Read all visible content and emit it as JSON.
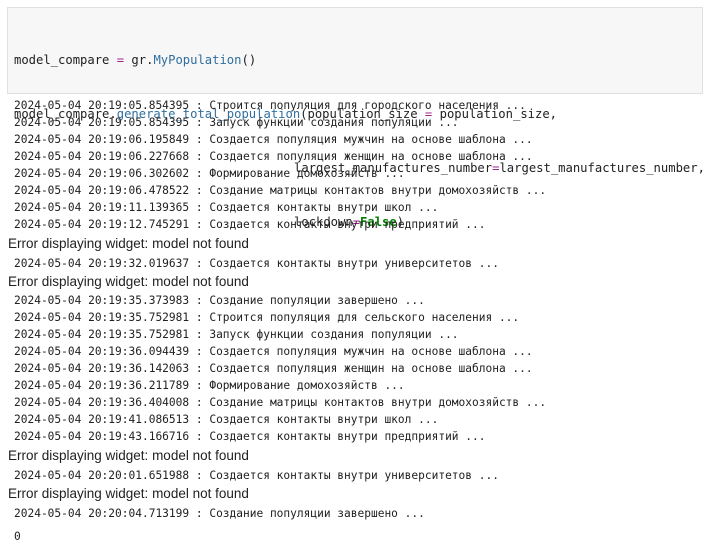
{
  "code": {
    "l1_var": "model_compare",
    "l1_op": "=",
    "l1_obj": "gr.",
    "l1_fn": "MyPopulation",
    "l1_end": "()",
    "l2_obj": "model_compare.",
    "l2_fn": "generate_total_population",
    "l2_arg": "(population_size",
    "l2_op": "=",
    "l2_rest": " population_size,",
    "l3_arg": "largest_manufactures_number",
    "l3_op": "=",
    "l3_rest": "largest_manufactures_number,",
    "l4_arg": "lockdown",
    "l4_op": "=",
    "l4_kw": "False",
    "l4_end": ")"
  },
  "output": {
    "log_1": [
      "2024-05-04 20:19:05.854395 : Строится популяция для городского населения ...",
      "2024-05-04 20:19:05.854395 : Запуск функции создания популяции ...",
      "2024-05-04 20:19:06.195849 : Создается популяция мужчин на основе шаблона ...",
      "2024-05-04 20:19:06.227668 : Создается популяция женщин на основе шаблона ...",
      "2024-05-04 20:19:06.302602 : Формирование домохозяйств ...",
      "2024-05-04 20:19:06.478522 : Создание матрицы контактов внутри домохозяйств ...",
      "2024-05-04 20:19:11.139365 : Создается контакты внутри школ ...",
      "2024-05-04 20:19:12.745291 : Создается контакты внутри предприятий ..."
    ],
    "error_1": "Error displaying widget: model not found",
    "log_2": [
      "2024-05-04 20:19:32.019637 : Создается контакты внутри университетов ..."
    ],
    "error_2": "Error displaying widget: model not found",
    "log_3": [
      "2024-05-04 20:19:35.373983 : Создание популяции завершено ...",
      "2024-05-04 20:19:35.752981 : Строится популяция для сельского населения ...",
      "2024-05-04 20:19:35.752981 : Запуск функции создания популяции ...",
      "2024-05-04 20:19:36.094439 : Создается популяция мужчин на основе шаблона ...",
      "2024-05-04 20:19:36.142063 : Создается популяция женщин на основе шаблона ...",
      "2024-05-04 20:19:36.211789 : Формирование домохозяйств ...",
      "2024-05-04 20:19:36.404008 : Создание матрицы контактов внутри домохозяйств ...",
      "2024-05-04 20:19:41.086513 : Создается контакты внутри школ ...",
      "2024-05-04 20:19:43.166716 : Создается контакты внутри предприятий ..."
    ],
    "error_3": "Error displaying widget: model not found",
    "log_4": [
      "2024-05-04 20:20:01.651988 : Создается контакты внутри университетов ..."
    ],
    "error_4": "Error displaying widget: model not found",
    "log_5": [
      "2024-05-04 20:20:04.713199 : Создание популяции завершено ..."
    ],
    "result": "0"
  }
}
